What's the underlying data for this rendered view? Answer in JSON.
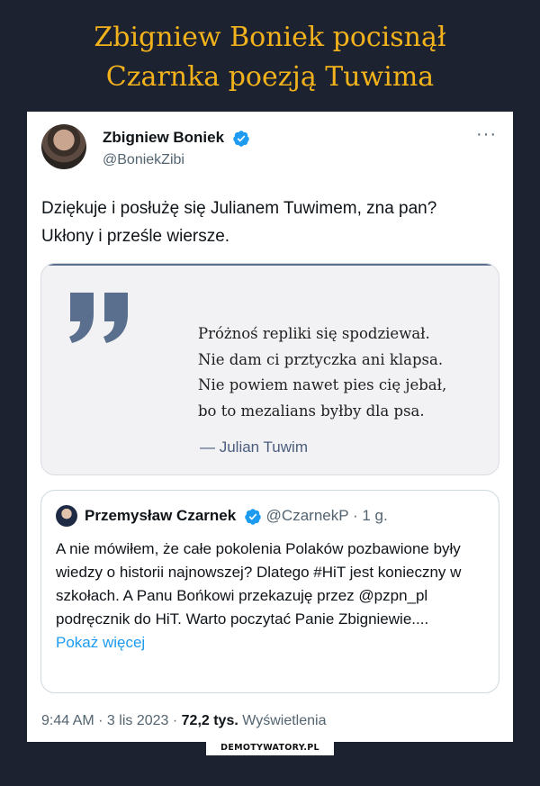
{
  "headline": {
    "line1": "Zbigniew Boniek pocisnął",
    "line2": "Czarnka poezją Tuwima"
  },
  "tweet": {
    "author_name": "Zbigniew Boniek",
    "author_handle": "@BoniekZibi",
    "more_icon": "ellipsis-icon",
    "text": "Dziękuje i posłużę się Julianem Tuwimem,  zna pan? Ukłony i prześle wiersze.",
    "image_quote": {
      "lines": [
        "Próżnoś repliki się spodziewał.",
        "Nie dam ci prztyczka ani klapsa.",
        "Nie powiem nawet pies cię jebał,",
        "bo to mezalians byłby dla psa."
      ],
      "attribution": "— Julian Tuwim"
    },
    "quoted_tweet": {
      "author_name": "Przemysław Czarnek",
      "handle": "@CzarnekP",
      "time": "· 1 g.",
      "text": "A nie mówiłem, że całe pokolenia Polaków pozbawione były wiedzy o historii najnowszej? Dlatego #HiT jest konieczny w szkołach. A Panu Bońkowi przekazuję przez @pzpn_pl podręcznik do HiT. Warto poczytać Panie Zbigniewie....",
      "show_more": "Pokaż więcej"
    },
    "timestamp": "9:44 AM · 3 lis 2023 ·",
    "views_count": "72,2 tys.",
    "views_label": "Wyświetlenia"
  },
  "watermark": "DEMOTYWATORY.PL",
  "colors": {
    "background": "#1d2230",
    "headline": "#f2b21c",
    "verified": "#1d9bf0",
    "link": "#1d9bf0"
  }
}
